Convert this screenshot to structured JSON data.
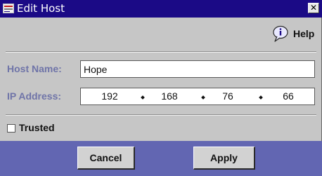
{
  "window": {
    "title": "Edit Host",
    "close_glyph": "✕"
  },
  "help": {
    "label": "Help",
    "icon": "help-speech-bubble-icon"
  },
  "form": {
    "host_name_label": "Host Name:",
    "host_name_value": "Hope",
    "ip_address_label": "IP Address:",
    "ip_octets": [
      "192",
      "168",
      "76",
      "66"
    ],
    "trusted_label": "Trusted",
    "trusted_checked": false
  },
  "buttons": {
    "cancel": "Cancel",
    "apply": "Apply"
  },
  "colors": {
    "title_bar": "#1b0a86",
    "footer": "#6266b2",
    "label_text": "#6f74a8",
    "panel_bg": "#c6c6c6"
  }
}
